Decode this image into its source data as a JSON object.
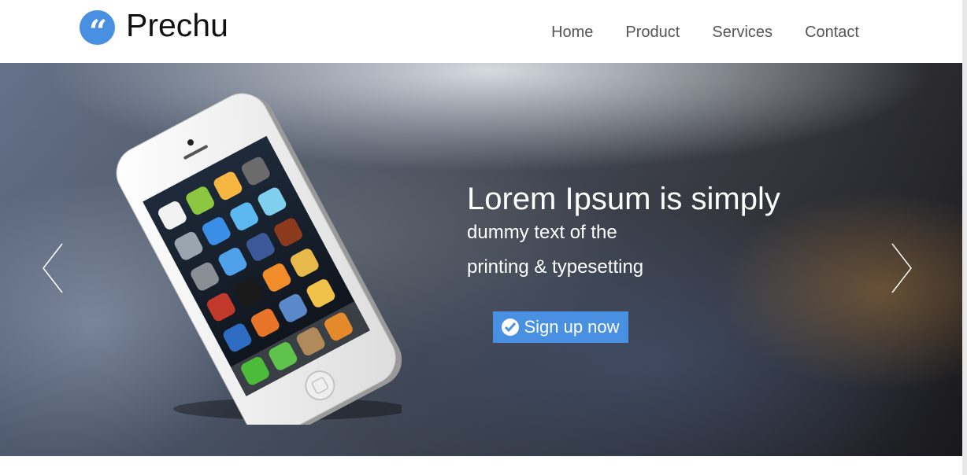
{
  "brand": {
    "logo_icon": "quote-icon",
    "logo_glyph": "“",
    "name": "Prechu",
    "accent_color": "#4a90e2"
  },
  "nav": {
    "items": [
      {
        "label": "Home"
      },
      {
        "label": "Product"
      },
      {
        "label": "Services"
      },
      {
        "label": "Contact"
      }
    ]
  },
  "hero": {
    "headline": "Lorem Ipsum is simply",
    "line1": "dummy text of the",
    "line2": "printing & typesetting",
    "cta_label": "Sign up now",
    "cta_icon": "check-circle-icon",
    "prev_icon": "chevron-left-icon",
    "next_icon": "chevron-right-icon",
    "image": "smartphone-image"
  }
}
